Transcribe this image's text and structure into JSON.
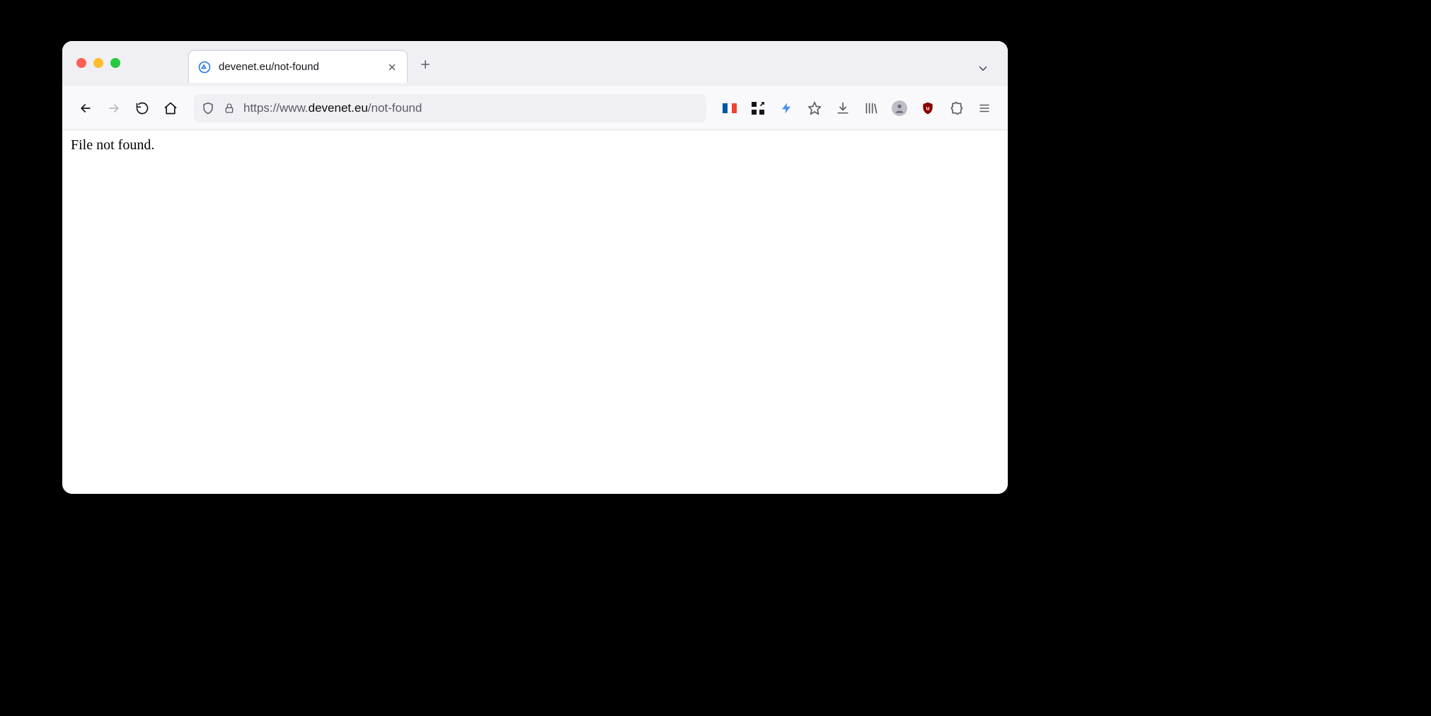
{
  "tab": {
    "title": "devenet.eu/not-found"
  },
  "url": {
    "prefix": "https://www.",
    "host": "devenet.eu",
    "path": "/not-found"
  },
  "page": {
    "body_text": "File not found."
  }
}
